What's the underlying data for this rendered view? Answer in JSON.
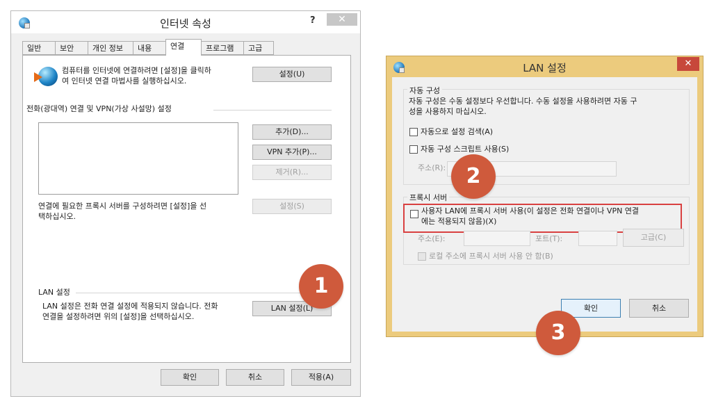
{
  "win1": {
    "title": "인터넷 속성",
    "help": "?",
    "close": "✕",
    "tabs": [
      "일반",
      "보안",
      "개인 정보",
      "내용",
      "연결",
      "프로그램",
      "고급"
    ],
    "setup_text_1": "컴퓨터를 인터넷에 연결하려면 [설정]을 클릭하",
    "setup_text_2": "여 인터넷 연결 마법사를 실행하십시오.",
    "setup_button": "설정(U)",
    "dialup_heading": "전화(광대역) 연결 및 VPN(가상 사설망) 설정",
    "add_button": "추가(D)...",
    "add_vpn_button": "VPN 추가(P)...",
    "remove_button": "제거(R)...",
    "proxy_text_1": "연결에 필요한 프록시 서버를 구성하려면 [설정]을 선",
    "proxy_text_2": "택하십시오.",
    "settings_button": "설정(S)",
    "lan_heading": "LAN 설정",
    "lan_text_1": "LAN 설정은 전화 연결 설정에 적용되지 않습니다. 전화",
    "lan_text_2": "연결을 설정하려면 위의 [설정]을 선택하십시오.",
    "lan_button": "LAN 설정(L)",
    "ok": "확인",
    "cancel": "취소",
    "apply": "적용(A)"
  },
  "win2": {
    "title": "LAN 설정",
    "close": "✕",
    "auto_group": "자동 구성",
    "auto_desc_1": "자동 구성은 수동 설정보다 우선합니다. 수동 설정을 사용하려면 자동 구",
    "auto_desc_2": "성을 사용하지 마십시오.",
    "auto_detect": "자동으로 설정 검색(A)",
    "auto_script": "자동 구성 스크립트 사용(S)",
    "address_label": "주소(R):",
    "proxy_group": "프록시 서버",
    "proxy_use_1": "사용자 LAN에 프록시 서버 사용(이 설정은 전화 연결이나 VPN 연결",
    "proxy_use_2": "에는 적용되지 않음)(X)",
    "proxy_address_label": "주소(E):",
    "port_label": "포트(T):",
    "advanced_button": "고급(C)",
    "bypass_local": "로컬 주소에 프록시 서버 사용 안 함(B)",
    "ok": "확인",
    "cancel": "취소"
  },
  "badges": [
    "1",
    "2",
    "3"
  ],
  "colors": {
    "badge": "#cf5a3c",
    "lan_frame": "#eccb7d",
    "close_red": "#c7483b",
    "highlight": "#d94040"
  }
}
